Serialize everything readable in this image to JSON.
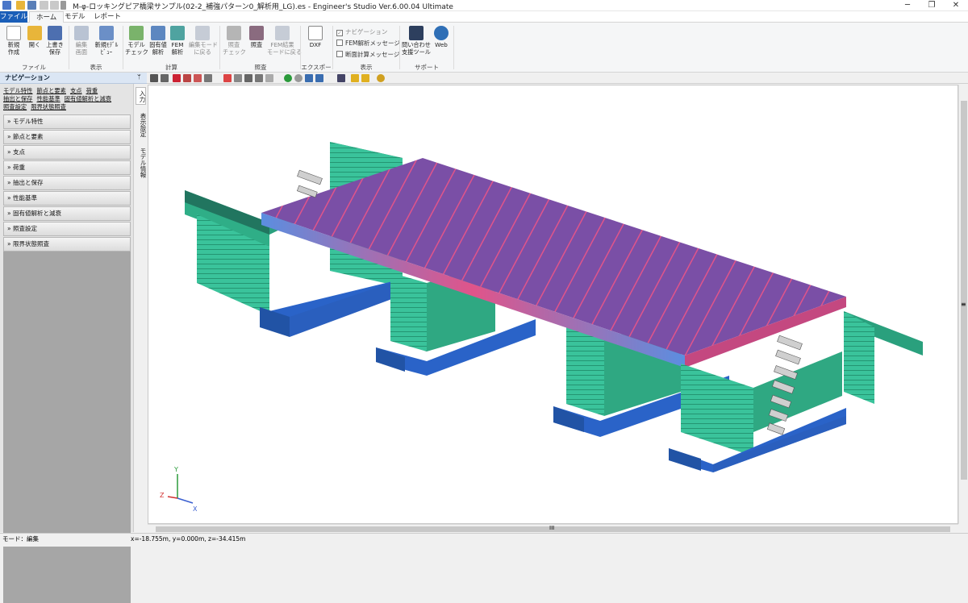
{
  "window": {
    "title": "M-φ-ロッキングピア橋梁サンプル(02-2_補強パターン0_解析用_LG).es - Engineer's Studio Ver.6.00.04 Ultimate",
    "minimize": "─",
    "restore": "❐",
    "close": "✕"
  },
  "tabs": {
    "file": "ファイル",
    "home": "ホーム",
    "model": "モデル",
    "report": "レポート"
  },
  "ribbon": {
    "new": "新規\n作成",
    "open": "開く",
    "save": "上書き\n保存",
    "group_file": "ファイル",
    "edit_screen": "編集\n画面",
    "new_model_view": "新規ﾓﾃﾞﾙ\nﾋﾞｭｰ",
    "group_view": "表示",
    "model_check": "モデル\nチェック",
    "eigen": "固有値\n解析",
    "fem": "FEM\n解析",
    "back_edit": "編集モード\nに戻る",
    "group_calc": "計算",
    "verify_check": "照査\nチェック",
    "verify": "照査",
    "back_fem": "FEM結果\nモードに戻る",
    "group_verify": "照査",
    "dxf": "DXF",
    "group_export": "エクスポート",
    "chk_nav": "ナビゲーション",
    "chk_fem_msg": "FEM解析メッセージ",
    "chk_section_msg": "断面計算メッセージ",
    "group_display": "表示",
    "support_tool": "問い合わせ\n支援ツール",
    "web": "Web",
    "group_support": "サポート"
  },
  "nav": {
    "title": "ナビゲーション",
    "pin": "ᛘ",
    "links": [
      "モデル特性",
      "節点と要素",
      "支点",
      "荷重",
      "抽出と保存",
      "性能基準",
      "固有値解析と減衰",
      "照査設定",
      "限界状態照査"
    ],
    "items": [
      "モデル特性",
      "節点と要素",
      "支点",
      "荷重",
      "抽出と保存",
      "性能基準",
      "固有値解析と減衰",
      "照査設定",
      "限界状態照査"
    ],
    "vtabs": [
      "入力",
      "表示設定",
      "モデル情報"
    ]
  },
  "axes": {
    "y": "Y",
    "z": "Z",
    "x": "X"
  },
  "status": {
    "mode": "モード：編集",
    "coords": "x=-18.755m, y=0.000m, z=-34.415m"
  },
  "scroll": {
    "h_grip": "III",
    "v_grip": "≡"
  },
  "colors": {
    "pier": "#3ac39b",
    "footing": "#2a63c8",
    "deck": "#7a4fa6",
    "deckEdge": "#e0548a",
    "accent": "#1a5eb8"
  }
}
